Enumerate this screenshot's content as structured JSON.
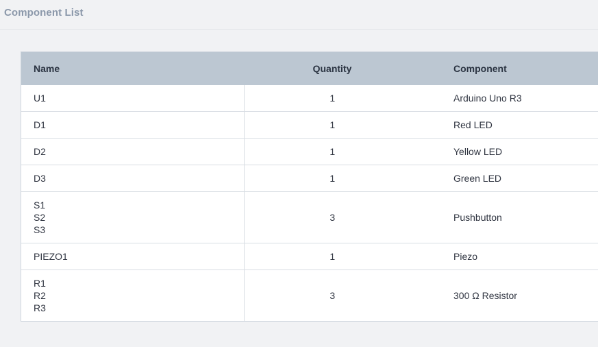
{
  "page": {
    "title": "Component List"
  },
  "table": {
    "headers": {
      "name": "Name",
      "quantity": "Quantity",
      "component": "Component"
    },
    "rows": [
      {
        "designators": [
          "U1"
        ],
        "quantity": "1",
        "component": "Arduino Uno R3"
      },
      {
        "designators": [
          "D1"
        ],
        "quantity": "1",
        "component": "Red LED"
      },
      {
        "designators": [
          "D2"
        ],
        "quantity": "1",
        "component": "Yellow LED"
      },
      {
        "designators": [
          "D3"
        ],
        "quantity": "1",
        "component": "Green LED"
      },
      {
        "designators": [
          "S1",
          "S2",
          "S3"
        ],
        "quantity": "3",
        "component": "Pushbutton"
      },
      {
        "designators": [
          "PIEZO1"
        ],
        "quantity": "1",
        "component": "Piezo"
      },
      {
        "designators": [
          "R1",
          "R2",
          "R3"
        ],
        "quantity": "3",
        "component": "300 Ω Resistor"
      }
    ]
  }
}
